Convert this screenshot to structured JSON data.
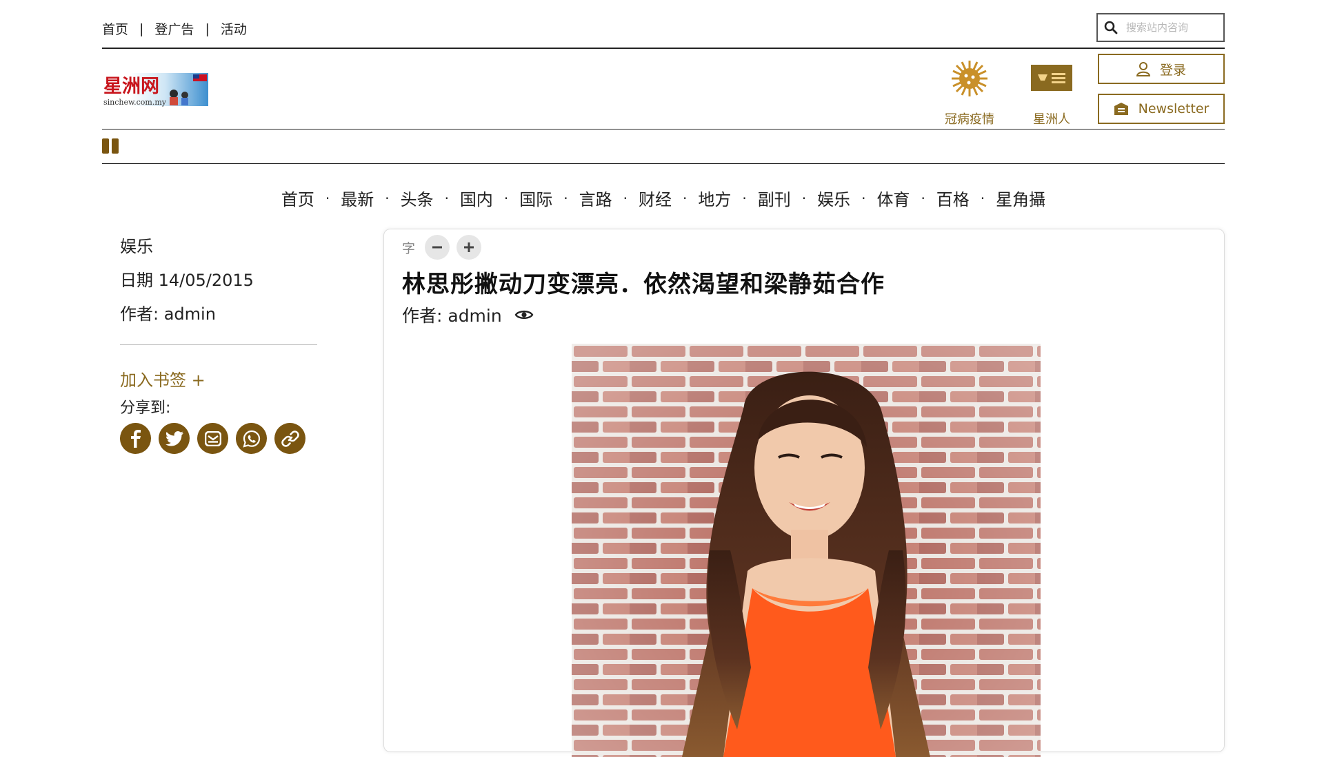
{
  "top_links": [
    "首页",
    "登广告",
    "活动"
  ],
  "search": {
    "placeholder": "搜索站内咨询"
  },
  "logo": {
    "text": "星洲网",
    "sub": "sinchew.com.my"
  },
  "header_icons": [
    {
      "label": "冠病疫情",
      "icon": "virus-icon"
    },
    {
      "label": "星洲人",
      "icon": "sinchew-people-icon"
    }
  ],
  "header_buttons": {
    "login": "登录",
    "newsletter": "Newsletter"
  },
  "nav": [
    "首页",
    "最新",
    "头条",
    "国内",
    "国际",
    "言路",
    "财经",
    "地方",
    "副刊",
    "娱乐",
    "体育",
    "百格",
    "星角攝"
  ],
  "nav_separator": "·",
  "meta": {
    "category": "娱乐",
    "date": "日期 14/05/2015",
    "author": "作者: admin"
  },
  "bookmark_label": "加入书签 +",
  "share_label": "分享到:",
  "share_icons": [
    "facebook-icon",
    "twitter-icon",
    "email-icon",
    "whatsapp-icon",
    "link-icon"
  ],
  "article": {
    "font_size_label": "字",
    "title": "林思彤撇动刀变漂亮．依然渴望和梁静茹合作",
    "byline": "作者: admin"
  },
  "colors": {
    "accent": "#8a6a20",
    "dark_accent": "#7a5510",
    "rule": "#222222"
  }
}
